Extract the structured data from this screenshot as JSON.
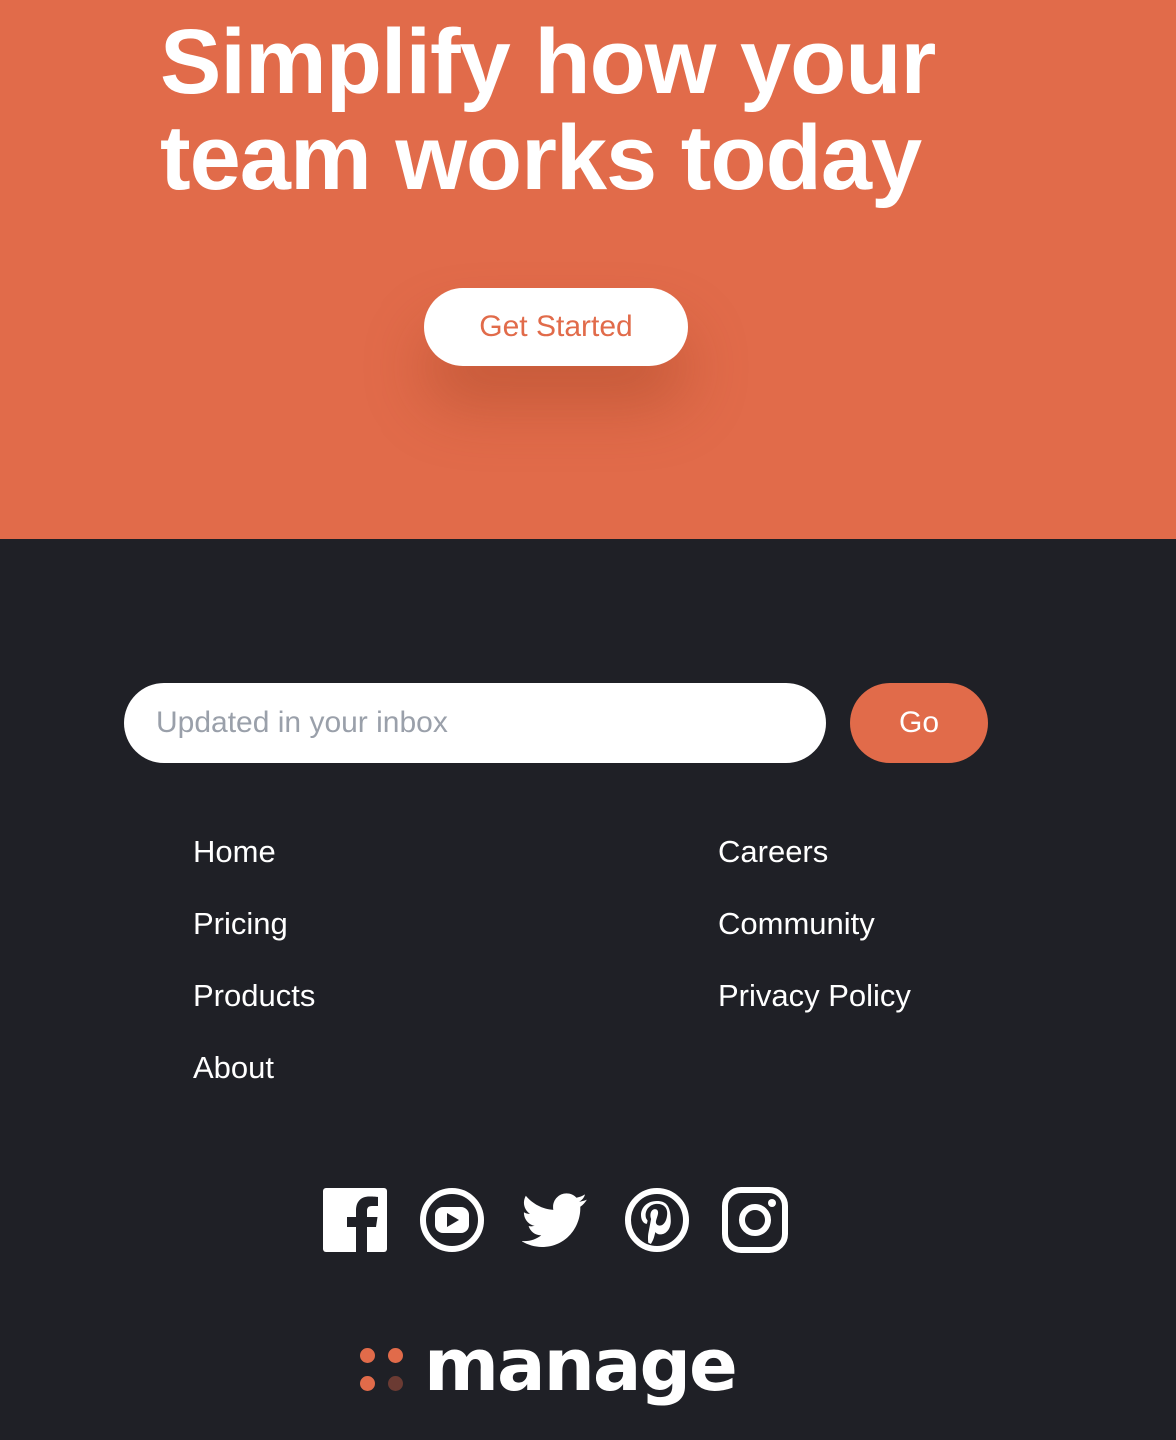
{
  "hero": {
    "title": "Simplify how your team works today",
    "cta_label": "Get Started"
  },
  "newsletter": {
    "placeholder": "Updated in your inbox",
    "submit_label": "Go"
  },
  "footer_links": {
    "left": [
      "Home",
      "Pricing",
      "Products",
      "About"
    ],
    "right": [
      "Careers",
      "Community",
      "Privacy Policy"
    ]
  },
  "social_icons": [
    "facebook-icon",
    "youtube-icon",
    "twitter-icon",
    "pinterest-icon",
    "instagram-icon"
  ],
  "brand": {
    "name": "manage"
  },
  "colors": {
    "accent": "#e16b4a",
    "footer_bg": "#1f2026",
    "text_light": "#ffffff",
    "placeholder": "#9aa0aa",
    "logo_dot_dark": "#6b3b33"
  }
}
